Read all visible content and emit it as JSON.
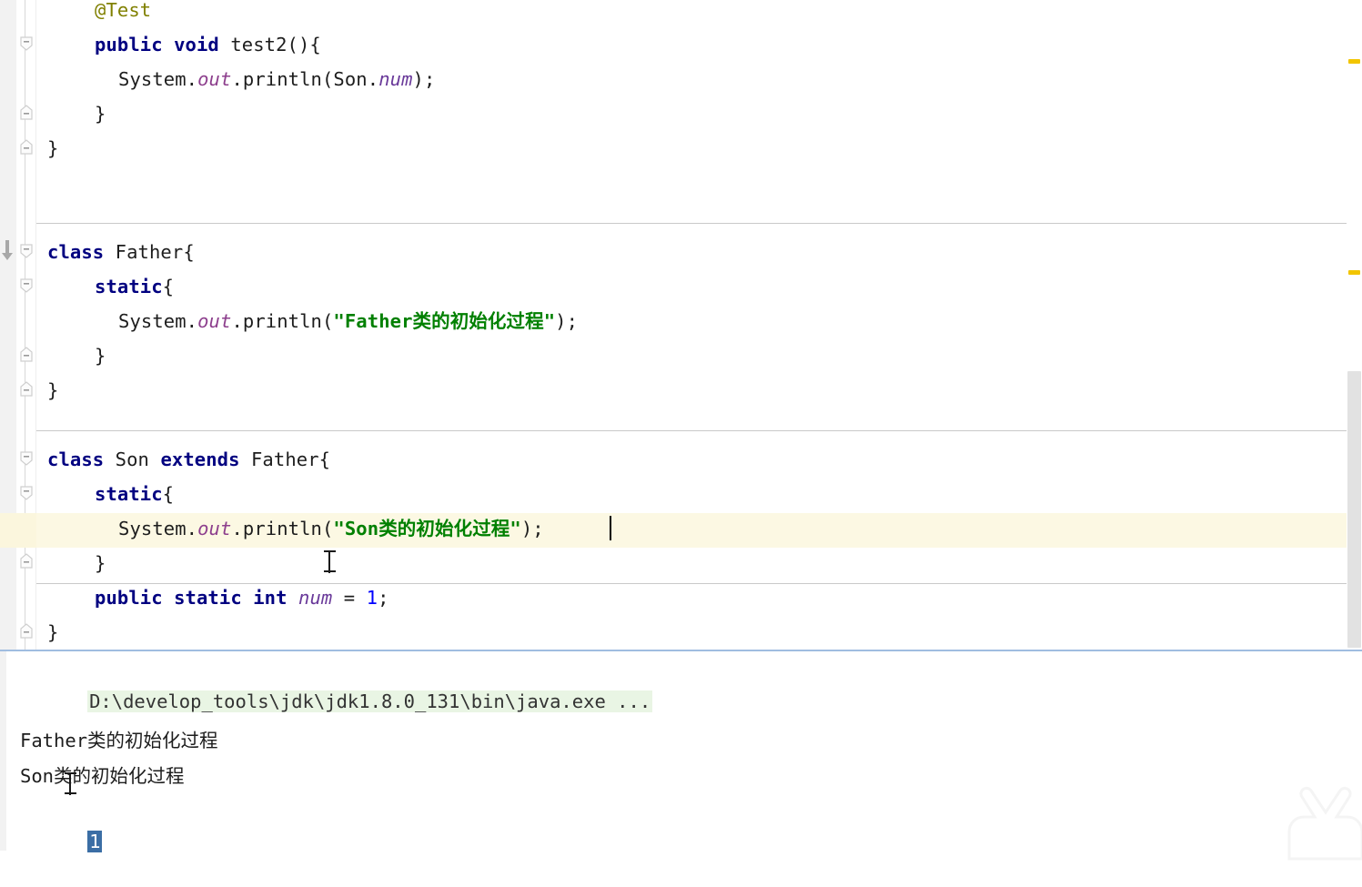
{
  "editor": {
    "lines": [
      {
        "indent": 2,
        "tokens": [
          {
            "t": "@Test",
            "c": "anno"
          }
        ]
      },
      {
        "indent": 2,
        "tokens": [
          {
            "t": "public",
            "c": "kw"
          },
          {
            "t": " ",
            "c": "plain"
          },
          {
            "t": "void",
            "c": "kw"
          },
          {
            "t": " test2(){",
            "c": "plain"
          }
        ]
      },
      {
        "indent": 3,
        "tokens": [
          {
            "t": "System.",
            "c": "plain"
          },
          {
            "t": "out",
            "c": "stat"
          },
          {
            "t": ".println(Son.",
            "c": "plain"
          },
          {
            "t": "num",
            "c": "fld"
          },
          {
            "t": ");",
            "c": "plain"
          }
        ]
      },
      {
        "indent": 2,
        "tokens": [
          {
            "t": "}",
            "c": "plain"
          }
        ]
      },
      {
        "indent": 0,
        "tokens": [
          {
            "t": "}",
            "c": "plain"
          }
        ]
      },
      {
        "indent": 0,
        "tokens": []
      },
      {
        "indent": 0,
        "tokens": []
      },
      {
        "indent": 0,
        "tokens": [
          {
            "t": "class",
            "c": "kw"
          },
          {
            "t": " Father{",
            "c": "plain"
          }
        ]
      },
      {
        "indent": 2,
        "tokens": [
          {
            "t": "static",
            "c": "kw"
          },
          {
            "t": "{",
            "c": "plain"
          }
        ]
      },
      {
        "indent": 3,
        "tokens": [
          {
            "t": "System.",
            "c": "plain"
          },
          {
            "t": "out",
            "c": "stat"
          },
          {
            "t": ".println(",
            "c": "plain"
          },
          {
            "t": "\"Father类的初始化过程\"",
            "c": "str"
          },
          {
            "t": ");",
            "c": "plain"
          }
        ]
      },
      {
        "indent": 2,
        "tokens": [
          {
            "t": "}",
            "c": "plain"
          }
        ]
      },
      {
        "indent": 0,
        "tokens": [
          {
            "t": "}",
            "c": "plain"
          }
        ]
      },
      {
        "indent": 0,
        "tokens": []
      },
      {
        "indent": 0,
        "tokens": [
          {
            "t": "class",
            "c": "kw"
          },
          {
            "t": " Son ",
            "c": "plain"
          },
          {
            "t": "extends",
            "c": "kw"
          },
          {
            "t": " Father{",
            "c": "plain"
          }
        ]
      },
      {
        "indent": 2,
        "tokens": [
          {
            "t": "static",
            "c": "kw"
          },
          {
            "t": "{",
            "c": "plain"
          }
        ]
      },
      {
        "indent": 3,
        "tokens": [
          {
            "t": "System.",
            "c": "plain"
          },
          {
            "t": "out",
            "c": "stat"
          },
          {
            "t": ".println(",
            "c": "plain"
          },
          {
            "t": "\"Son类的初始化过程\"",
            "c": "str"
          },
          {
            "t": ");",
            "c": "plain"
          }
        ]
      },
      {
        "indent": 2,
        "tokens": [
          {
            "t": "}",
            "c": "plain"
          }
        ]
      },
      {
        "indent": 2,
        "tokens": [
          {
            "t": "public",
            "c": "kw"
          },
          {
            "t": " ",
            "c": "plain"
          },
          {
            "t": "static",
            "c": "kw"
          },
          {
            "t": " ",
            "c": "plain"
          },
          {
            "t": "int",
            "c": "kw"
          },
          {
            "t": " ",
            "c": "plain"
          },
          {
            "t": "num",
            "c": "fld"
          },
          {
            "t": " = ",
            "c": "plain"
          },
          {
            "t": "1",
            "c": "num"
          },
          {
            "t": ";",
            "c": "plain"
          }
        ]
      },
      {
        "indent": 0,
        "tokens": [
          {
            "t": "}",
            "c": "plain"
          }
        ]
      }
    ],
    "current_line_index": 16,
    "colors": {
      "keyword": "#000080",
      "string": "#008000",
      "annotation": "#808000",
      "static_field": "#8d3f8d",
      "number": "#0000ff",
      "current_line_highlight": "#fcf8e3",
      "separator": "#c9c9c9",
      "warning_marker": "#f2c500"
    }
  },
  "console": {
    "command_line": "D:\\develop_tools\\jdk\\jdk1.8.0_131\\bin\\java.exe ...",
    "output_lines": [
      "Father类的初始化过程",
      "Son类的初始化过程"
    ],
    "selected_output": "1",
    "colors": {
      "command_background": "#e9f5e4",
      "selection_background": "#3b6ea5",
      "divider": "#a0bde0"
    }
  }
}
